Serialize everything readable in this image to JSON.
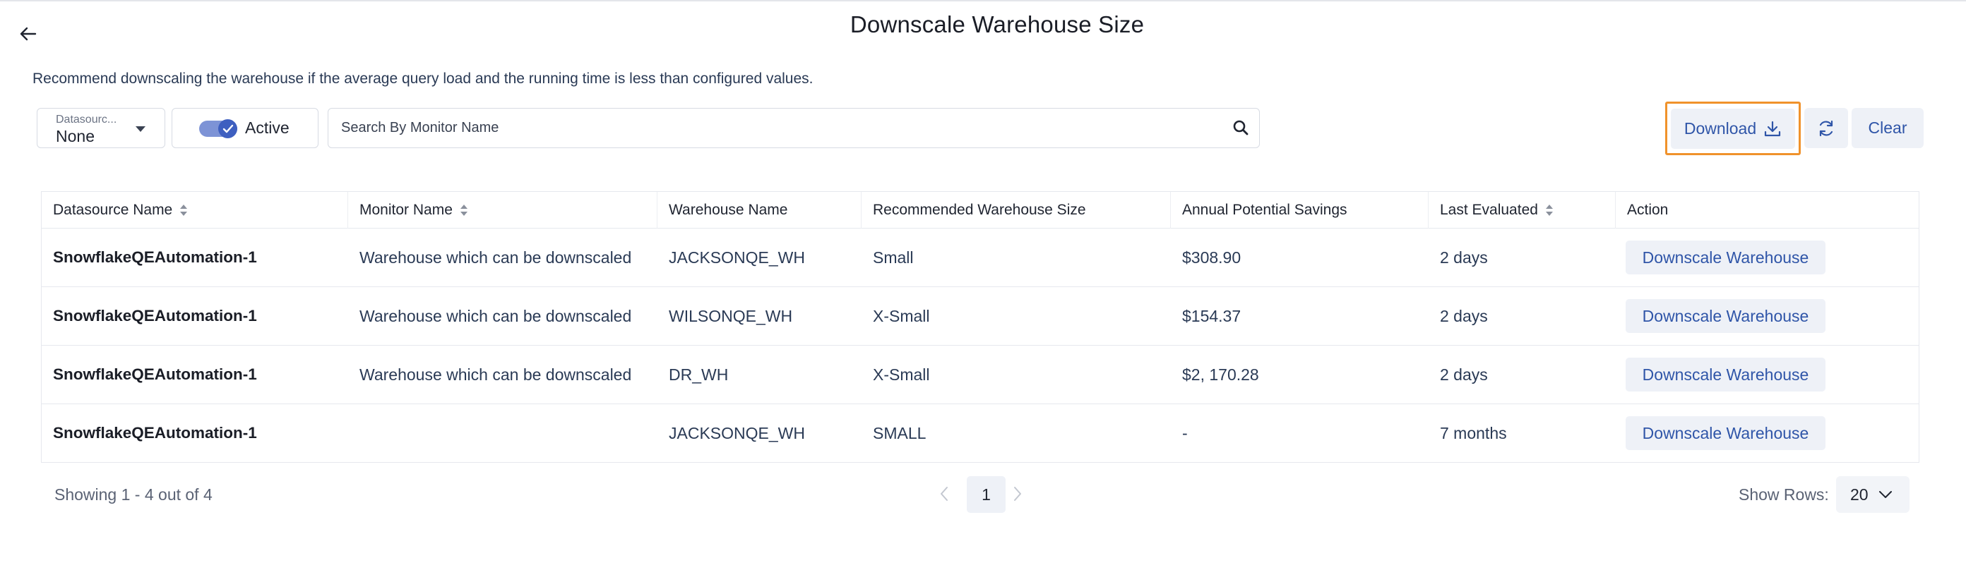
{
  "header": {
    "title": "Downscale Warehouse Size",
    "description": "Recommend downscaling the warehouse if the average query load and the running time is less than configured values."
  },
  "toolbar": {
    "datasource_label": "Datasourc...",
    "datasource_value": "None",
    "active_label": "Active",
    "active_on": true,
    "search_placeholder": "Search By Monitor Name",
    "download_label": "Download",
    "clear_label": "Clear"
  },
  "table": {
    "columns": [
      {
        "label": "Datasource Name",
        "sortable": true
      },
      {
        "label": "Monitor Name",
        "sortable": true
      },
      {
        "label": "Warehouse Name",
        "sortable": false
      },
      {
        "label": "Recommended Warehouse Size",
        "sortable": false
      },
      {
        "label": "Annual Potential Savings",
        "sortable": false
      },
      {
        "label": "Last Evaluated",
        "sortable": true
      },
      {
        "label": "Action",
        "sortable": false
      }
    ],
    "rows": [
      {
        "datasource": "SnowflakeQEAutomation-1",
        "monitor": "Warehouse which can be downscaled",
        "warehouse": "JACKSONQE_WH",
        "size": "Small",
        "savings": "$308.90",
        "evaluated": "2 days",
        "action": "Downscale Warehouse"
      },
      {
        "datasource": "SnowflakeQEAutomation-1",
        "monitor": "Warehouse which can be downscaled",
        "warehouse": "WILSONQE_WH",
        "size": "X-Small",
        "savings": "$154.37",
        "evaluated": "2 days",
        "action": "Downscale Warehouse"
      },
      {
        "datasource": "SnowflakeQEAutomation-1",
        "monitor": "Warehouse which can be downscaled",
        "warehouse": "DR_WH",
        "size": "X-Small",
        "savings": "$2, 170.28",
        "evaluated": "2 days",
        "action": "Downscale Warehouse"
      },
      {
        "datasource": "SnowflakeQEAutomation-1",
        "monitor": "",
        "warehouse": "JACKSONQE_WH",
        "size": "SMALL",
        "savings": "-",
        "evaluated": "7 months",
        "action": "Downscale Warehouse"
      }
    ]
  },
  "footer": {
    "showing": "Showing 1 - 4 out of 4",
    "current_page": "1",
    "rows_label": "Show Rows:",
    "rows_value": "20"
  },
  "colors": {
    "accent": "#2f55a8",
    "highlight": "#f0922b",
    "button_bg": "#eef1f7"
  }
}
